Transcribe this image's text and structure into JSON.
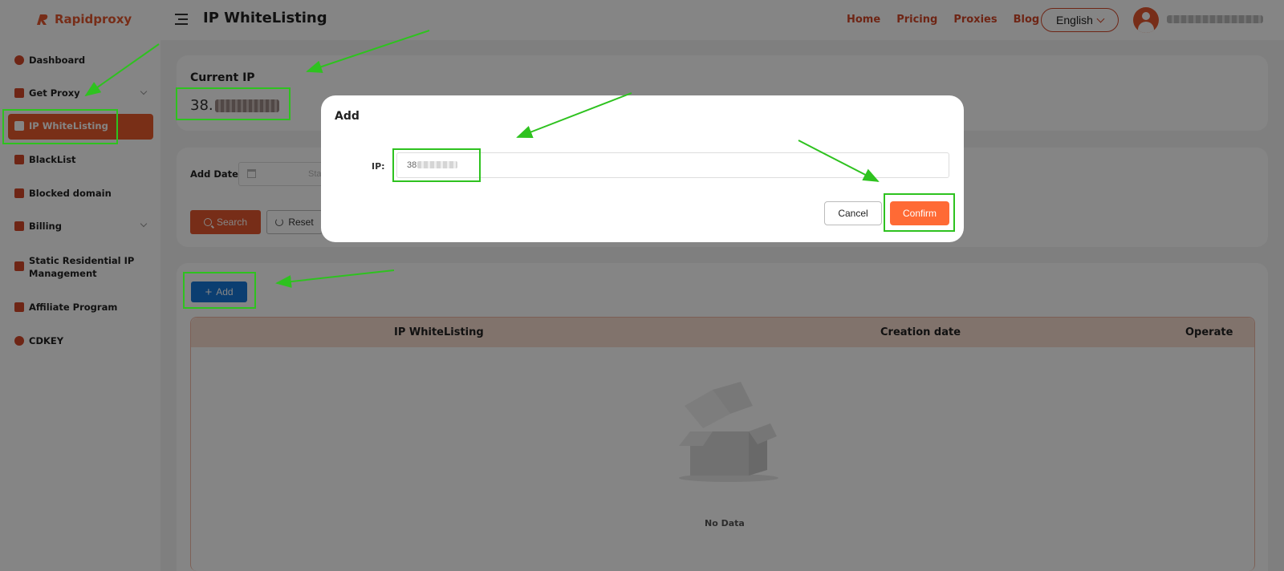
{
  "header": {
    "logo_text": "Rapidproxy",
    "page_title": "IP WhiteListing",
    "nav": [
      "Home",
      "Pricing",
      "Proxies",
      "Blog"
    ],
    "language": "English"
  },
  "sidebar": {
    "items": [
      {
        "label": "Dashboard",
        "icon": "user-icon"
      },
      {
        "label": "Get Proxy",
        "icon": "chip-icon"
      },
      {
        "label": "IP WhiteListing",
        "icon": "briefcase-icon"
      },
      {
        "label": "BlackList",
        "icon": "ticket-icon"
      },
      {
        "label": "Blocked domain",
        "icon": "monitor-icon"
      },
      {
        "label": "Billing",
        "icon": "billing-icon"
      },
      {
        "label": "Static Residential IP",
        "label2": "Management",
        "icon": "server-icon"
      },
      {
        "label": "Affiliate Program",
        "icon": "grid-icon"
      },
      {
        "label": "CDKEY",
        "icon": "key-icon"
      }
    ],
    "active_index": 2
  },
  "current_ip": {
    "title": "Current IP",
    "value_prefix": "38."
  },
  "filter": {
    "add_date_label": "Add Date",
    "date_placeholder": "Sta",
    "search_label": "Search",
    "reset_label": "Reset"
  },
  "list": {
    "add_label": "Add",
    "columns": [
      "IP WhiteListing",
      "Creation date",
      "Operate"
    ],
    "empty_text": "No Data"
  },
  "modal": {
    "title": "Add",
    "ip_label": "IP:",
    "ip_value": "38",
    "cancel_label": "Cancel",
    "confirm_label": "Confirm"
  },
  "colors": {
    "brand": "#e4572e",
    "accent_button": "#ff6a35",
    "add_button": "#1677d9",
    "annotation": "#2ec21f"
  }
}
